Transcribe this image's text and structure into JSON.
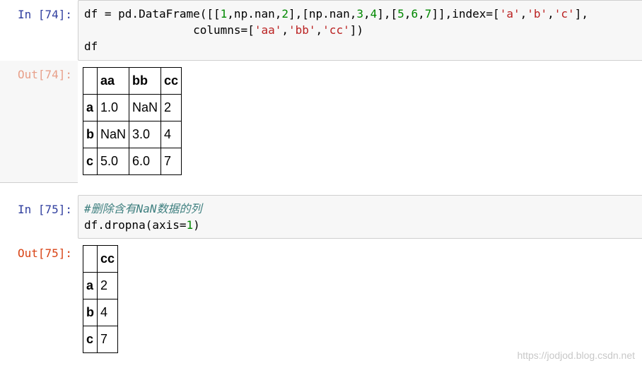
{
  "cells": [
    {
      "in_prompt": "In [74]:",
      "code_lines": [
        [
          {
            "t": "df = pd.DataFrame([[",
            "c": ""
          },
          {
            "t": "1",
            "c": "num"
          },
          {
            "t": ",np.nan,",
            "c": ""
          },
          {
            "t": "2",
            "c": "num"
          },
          {
            "t": "],[np.nan,",
            "c": ""
          },
          {
            "t": "3",
            "c": "num"
          },
          {
            "t": ",",
            "c": ""
          },
          {
            "t": "4",
            "c": "num"
          },
          {
            "t": "],[",
            "c": ""
          },
          {
            "t": "5",
            "c": "num"
          },
          {
            "t": ",",
            "c": ""
          },
          {
            "t": "6",
            "c": "num"
          },
          {
            "t": ",",
            "c": ""
          },
          {
            "t": "7",
            "c": "num"
          },
          {
            "t": "]],index=[",
            "c": ""
          },
          {
            "t": "'a'",
            "c": "str"
          },
          {
            "t": ",",
            "c": ""
          },
          {
            "t": "'b'",
            "c": "str"
          },
          {
            "t": ",",
            "c": ""
          },
          {
            "t": "'c'",
            "c": "str"
          },
          {
            "t": "],",
            "c": ""
          }
        ],
        [
          {
            "t": "                columns=[",
            "c": ""
          },
          {
            "t": "'aa'",
            "c": "str"
          },
          {
            "t": ",",
            "c": ""
          },
          {
            "t": "'bb'",
            "c": "str"
          },
          {
            "t": ",",
            "c": ""
          },
          {
            "t": "'cc'",
            "c": "str"
          },
          {
            "t": "])",
            "c": ""
          }
        ],
        [
          {
            "t": "df",
            "c": ""
          }
        ]
      ],
      "out_prompt": "Out[74]:",
      "table": {
        "columns": [
          "",
          "aa",
          "bb",
          "cc"
        ],
        "rows": [
          {
            "index": "a",
            "values": [
              "1.0",
              "NaN",
              "2"
            ]
          },
          {
            "index": "b",
            "values": [
              "NaN",
              "3.0",
              "4"
            ]
          },
          {
            "index": "c",
            "values": [
              "5.0",
              "6.0",
              "7"
            ]
          }
        ]
      }
    },
    {
      "in_prompt": "In [75]:",
      "code_lines": [
        [
          {
            "t": "#删除含有NaN数据的列",
            "c": "cmt"
          }
        ],
        [
          {
            "t": "df.dropna(axis=",
            "c": ""
          },
          {
            "t": "1",
            "c": "num"
          },
          {
            "t": ")",
            "c": ""
          }
        ]
      ],
      "out_prompt": "Out[75]:",
      "table": {
        "columns": [
          "",
          "cc"
        ],
        "rows": [
          {
            "index": "a",
            "values": [
              "2"
            ]
          },
          {
            "index": "b",
            "values": [
              "4"
            ]
          },
          {
            "index": "c",
            "values": [
              "7"
            ]
          }
        ]
      }
    }
  ],
  "watermark": "https://jodjod.blog.csdn.net"
}
